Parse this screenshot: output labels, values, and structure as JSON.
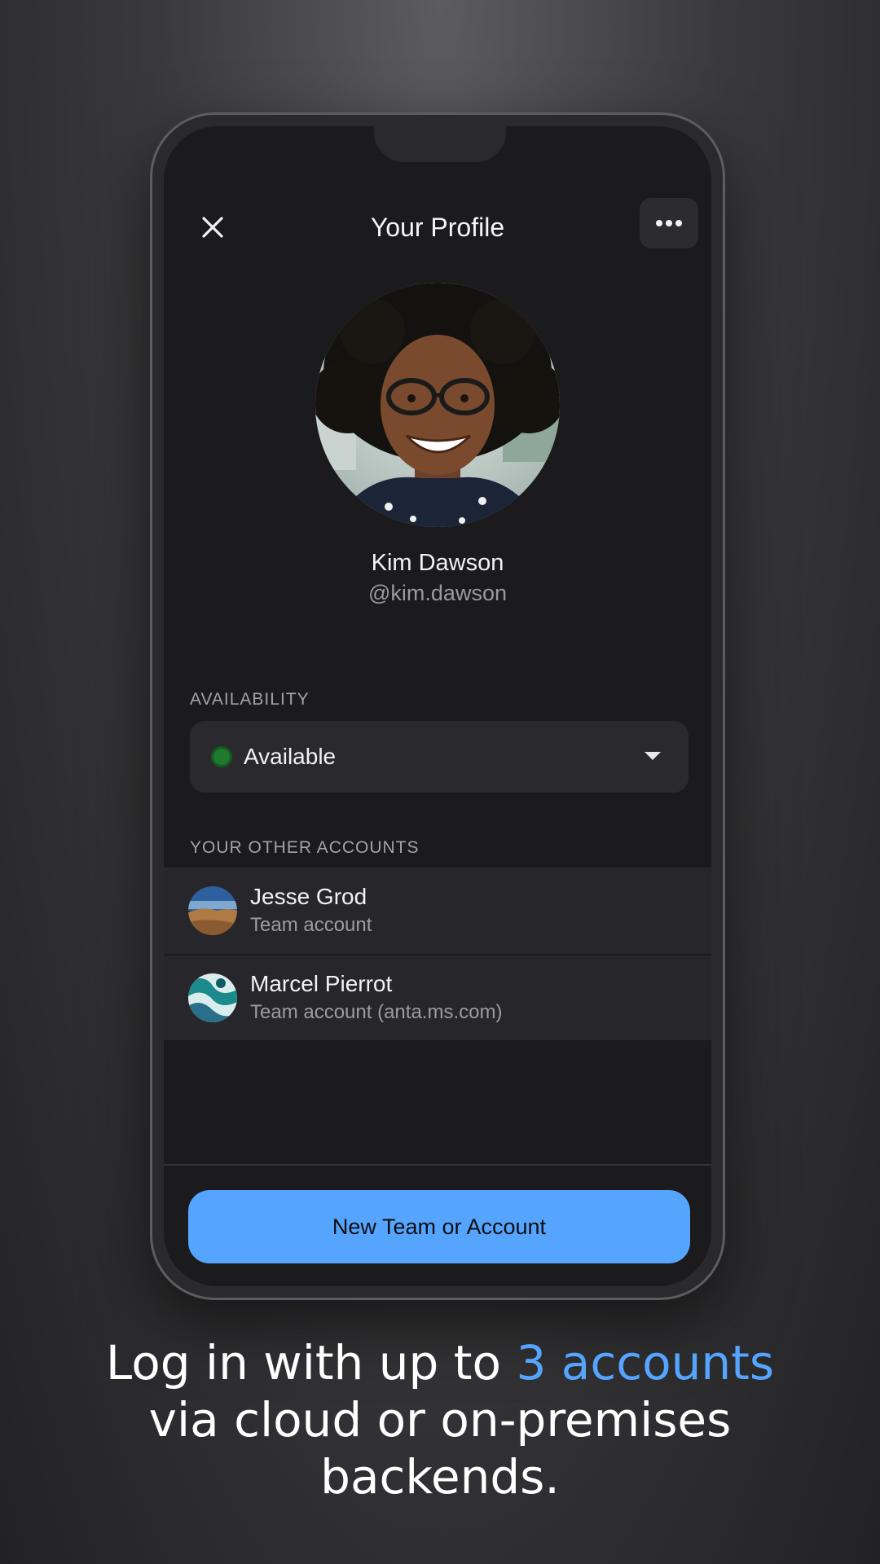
{
  "header": {
    "title": "Your Profile"
  },
  "icons": {
    "close": "close-icon",
    "more": "more-horizontal-icon",
    "dropdown": "chevron-down-icon"
  },
  "profile": {
    "name": "Kim Dawson",
    "handle": "@kim.dawson"
  },
  "availability": {
    "label": "AVAILABILITY",
    "value": "Available",
    "status_color": "#1f7a2f"
  },
  "other_accounts": {
    "label": "YOUR OTHER ACCOUNTS",
    "items": [
      {
        "name": "Jesse Grod",
        "subtitle": "Team account"
      },
      {
        "name": "Marcel Pierrot",
        "subtitle": "Team account (anta.ms.com)"
      }
    ]
  },
  "actions": {
    "new_account": "New Team or Account"
  },
  "caption": {
    "part1": "Log in with up to ",
    "highlight": "3 accounts",
    "part2": "via cloud or on-premises backends."
  },
  "colors": {
    "accent": "#55a5ff",
    "screen_bg": "#1b1b1d",
    "row_bg": "#27272b"
  }
}
